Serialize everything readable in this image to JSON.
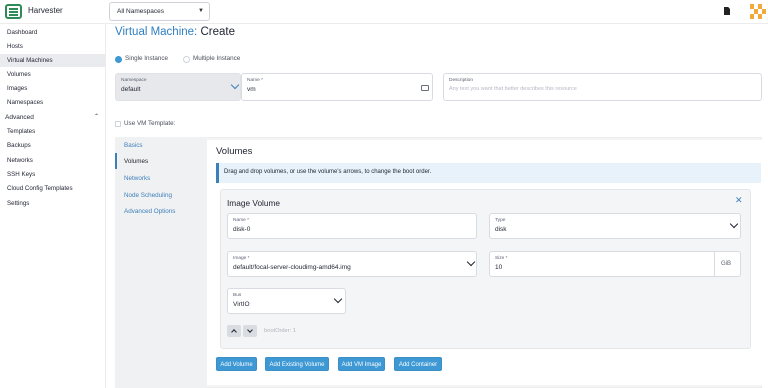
{
  "app": {
    "name": "Harvester",
    "logo_icon": "harvester-logo-icon"
  },
  "header": {
    "namespace_filter": "All Namespaces",
    "doc_icon": "document-icon",
    "avatar_icon": "user-avatar"
  },
  "sidebar": {
    "items": [
      {
        "label": "Dashboard"
      },
      {
        "label": "Hosts"
      },
      {
        "label": "Virtual Machines",
        "active": true
      },
      {
        "label": "Volumes"
      },
      {
        "label": "Images"
      },
      {
        "label": "Namespaces"
      }
    ],
    "group": {
      "label": "Advanced",
      "expanded": true
    },
    "sub_items": [
      {
        "label": "Templates"
      },
      {
        "label": "Backups"
      },
      {
        "label": "Networks"
      },
      {
        "label": "SSH Keys"
      },
      {
        "label": "Cloud Config Templates"
      },
      {
        "label": "Settings"
      }
    ]
  },
  "page": {
    "title_prefix": "Virtual Machine:",
    "title_action": "Create",
    "instance_mode": {
      "single": "Single Instance",
      "multiple": "Multiple Instance",
      "selected": "single"
    },
    "namespace": {
      "label": "Namespace",
      "value": "default"
    },
    "name": {
      "label": "Name *",
      "value": "vm"
    },
    "description": {
      "label": "Description",
      "placeholder": "Any text you want that better describes this resource"
    },
    "use_template": {
      "label": "Use VM Template:",
      "checked": false
    }
  },
  "tabs": [
    {
      "label": "Basics"
    },
    {
      "label": "Volumes",
      "active": true
    },
    {
      "label": "Networks"
    },
    {
      "label": "Node Scheduling"
    },
    {
      "label": "Advanced Options"
    }
  ],
  "volumes": {
    "title": "Volumes",
    "banner": "Drag and drop volumes, or use the volume's arrows, to change the boot order.",
    "card": {
      "title": "Image Volume",
      "name": {
        "label": "Name *",
        "value": "disk-0"
      },
      "type": {
        "label": "Type",
        "value": "disk"
      },
      "image": {
        "label": "Image *",
        "value": "default/focal-server-cloudimg-amd64.img"
      },
      "size": {
        "label": "Size *",
        "value": "10",
        "unit": "GiB"
      },
      "bus": {
        "label": "Bus",
        "value": "VirtIO"
      },
      "boot_order": "bootOrder: 1"
    },
    "buttons": {
      "add_volume": "Add Volume",
      "add_existing": "Add Existing Volume",
      "add_vm_image": "Add VM Image",
      "add_container": "Add Container"
    }
  },
  "colors": {
    "accent": "#3d98d3",
    "link": "#3d7fb8",
    "title_blue": "#2f7ec0"
  }
}
